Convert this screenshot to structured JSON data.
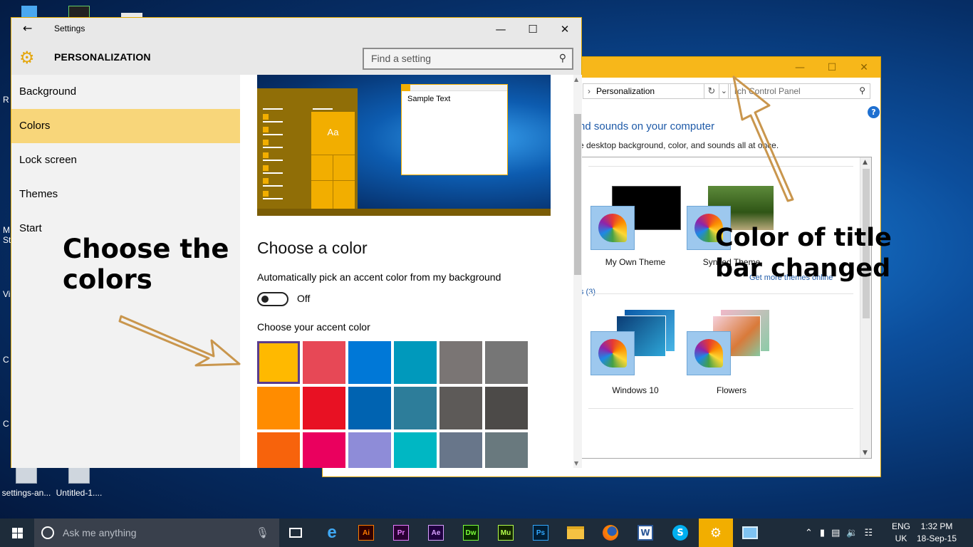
{
  "desktop": {
    "icons": [
      {
        "label": "settings-an..."
      },
      {
        "label": "Untitled-1...."
      }
    ],
    "edge_labels": [
      "R",
      "M",
      "St",
      "Vi",
      "C",
      "C"
    ]
  },
  "control_panel": {
    "address": "Personalization",
    "search_placeholder": "Search Control Panel",
    "search_visible": "rch Control Panel",
    "heading": "nd sounds on your computer",
    "subheading": "e desktop background, color, and sounds all at once.",
    "themes_row1": [
      {
        "label": "My Own Theme"
      },
      {
        "label": "Synced Theme"
      }
    ],
    "get_more_link": "Get more themes online",
    "group_label": "s (3)",
    "themes_row2": [
      {
        "label": "Windows 10"
      },
      {
        "label": "Flowers"
      }
    ],
    "title_bar_color": "#f7b71a"
  },
  "settings": {
    "window_title": "Settings",
    "page_title": "PERSONALIZATION",
    "search_placeholder": "Find a setting",
    "nav": [
      {
        "label": "Background",
        "selected": false
      },
      {
        "label": "Colors",
        "selected": true
      },
      {
        "label": "Lock screen",
        "selected": false
      },
      {
        "label": "Themes",
        "selected": false
      },
      {
        "label": "Start",
        "selected": false
      }
    ],
    "preview": {
      "tile_text": "Aa",
      "sample_text": "Sample Text"
    },
    "choose_color_heading": "Choose a color",
    "auto_pick_label": "Automatically pick an accent color from my background",
    "auto_pick_state": "Off",
    "accent_label": "Choose your accent color",
    "accent_colors": [
      "#ffb900",
      "#e74856",
      "#0078d7",
      "#0099bc",
      "#7a7574",
      "#767676",
      "#ff8c00",
      "#e81123",
      "#0063b1",
      "#2d7d9a",
      "#5d5a58",
      "#4c4a48",
      "#f7630c",
      "#ea005e",
      "#8e8cd8",
      "#00b7c3",
      "#68768a",
      "#69797e"
    ],
    "selected_accent": "#ffb900"
  },
  "annotations": {
    "left_line1": "Choose the",
    "left_line2": "colors",
    "right_line1": "Color of title",
    "right_line2": "bar changed",
    "arrow_color": "#c9964d"
  },
  "taskbar": {
    "search_placeholder": "Ask me anything",
    "apps": [
      {
        "icon": "task-view-icon"
      },
      {
        "icon": "edge-icon"
      },
      {
        "icon": "illustrator-icon",
        "text": "Ai",
        "color": "#ff7c00",
        "bg": "#310000"
      },
      {
        "icon": "premiere-icon",
        "text": "Pr",
        "color": "#e77bff",
        "bg": "#2a0034"
      },
      {
        "icon": "after-effects-icon",
        "text": "Ae",
        "color": "#d8a1ff",
        "bg": "#1f0040"
      },
      {
        "icon": "dreamweaver-icon",
        "text": "Dw",
        "color": "#7cff3a",
        "bg": "#082c00"
      },
      {
        "icon": "muse-icon",
        "text": "Mu",
        "color": "#b4ff4c",
        "bg": "#132600"
      },
      {
        "icon": "photoshop-icon",
        "text": "Ps",
        "color": "#31a8ff",
        "bg": "#001e36"
      },
      {
        "icon": "file-explorer-icon"
      },
      {
        "icon": "firefox-icon"
      },
      {
        "icon": "word-icon"
      },
      {
        "icon": "skype-icon"
      }
    ],
    "lang": {
      "line1": "ENG",
      "line2": "UK"
    },
    "clock": {
      "time": "1:32 PM",
      "date": "18-Sep-15"
    }
  }
}
